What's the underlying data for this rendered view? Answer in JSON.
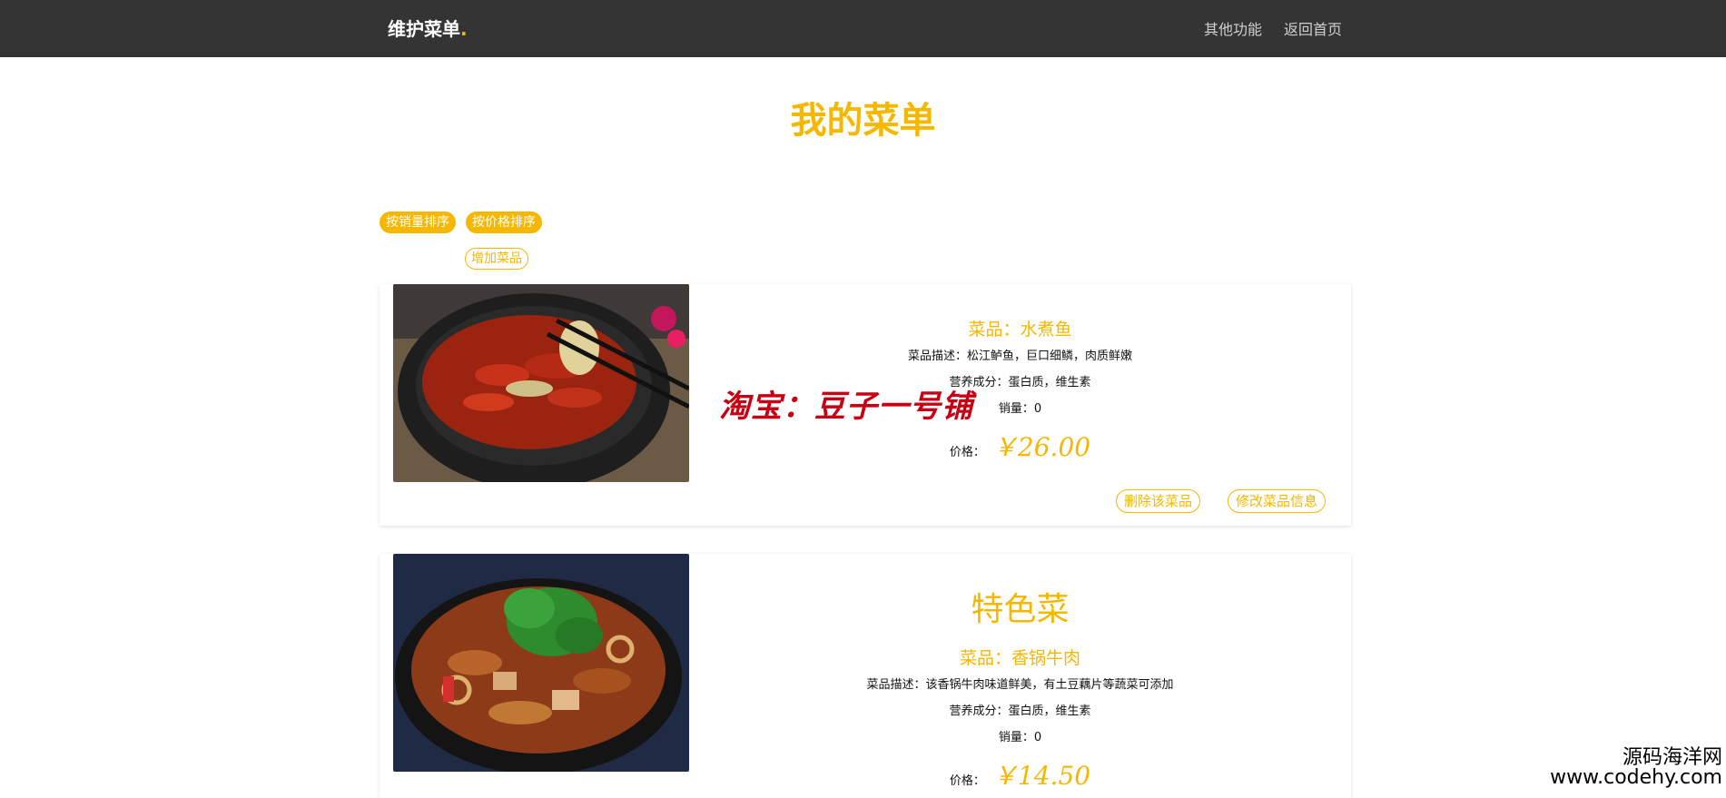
{
  "navbar": {
    "brand": "维护菜单",
    "brand_dot": ".",
    "links": [
      "其他功能",
      "返回首页"
    ]
  },
  "page_title": "我的菜单",
  "toolbar": {
    "sort_sales": "按销量排序",
    "sort_price": "按价格排序",
    "add_dish": "增加菜品"
  },
  "dishes": [
    {
      "name": "菜品：水煮鱼",
      "description": "菜品描述：松江鲈鱼，巨口细鳞，肉质鲜嫩",
      "nutrition": "营养成分：蛋白质，维生素",
      "sales": "销量：0",
      "price_label": "价格：",
      "price": "￥26.00",
      "delete_label": "删除该菜品",
      "edit_label": "修改菜品信息"
    },
    {
      "special_label": "特色菜",
      "name": "菜品：香锅牛肉",
      "description": "菜品描述：该香锅牛肉味道鲜美，有土豆藕片等蔬菜可添加",
      "nutrition": "营养成分：蛋白质，维生素",
      "sales": "销量：0",
      "price_label": "价格：",
      "price": "￥14.50"
    }
  ],
  "overlays": {
    "watermark": "淘宝：豆子一号铺",
    "corner_cn": "源码海洋网",
    "corner_en": "www.codehy.com"
  },
  "colors": {
    "accent": "#f5b700",
    "navbar": "#343434",
    "watermark": "#c80014"
  }
}
